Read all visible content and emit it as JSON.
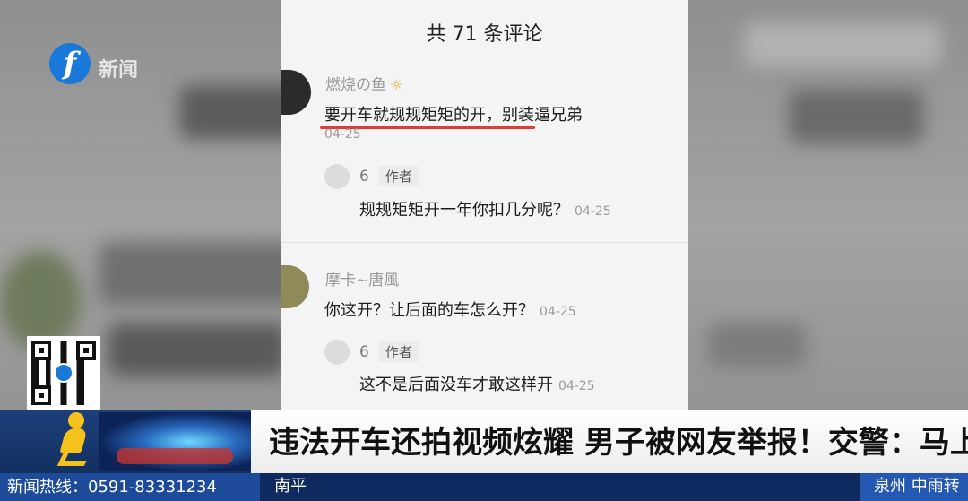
{
  "channel": {
    "logo_letter": "f",
    "logo_label": "新闻"
  },
  "comments_panel": {
    "title": "共 71 条评论",
    "comments": [
      {
        "username": "燃烧の鱼",
        "text": "要开车就规规矩矩的开，别装逼兄弟",
        "date": "04-25",
        "reply": {
          "username": "6",
          "badge": "作者",
          "text": "规规矩矩开一年你扣几分呢？",
          "date": "04-25"
        }
      },
      {
        "username": "摩卡~唐風",
        "text": "你这开？让后面的车怎么开？",
        "date": "04-25",
        "reply": {
          "username": "6",
          "badge": "作者",
          "text": "这不是后面没车才敢这样开",
          "date": "04-25"
        }
      }
    ]
  },
  "lower_third": {
    "headline": "违法开车还拍视频炫耀 男子被网友举报！交警：马上查"
  },
  "ticker": {
    "hotline": "新闻热线：0591-83331234",
    "left_text": "南平",
    "right_text": "泉州 中雨转"
  },
  "colors": {
    "accent_red": "#e23a3a",
    "brand_blue": "#1a78d8",
    "ticker_blue": "#0f2a5e"
  }
}
